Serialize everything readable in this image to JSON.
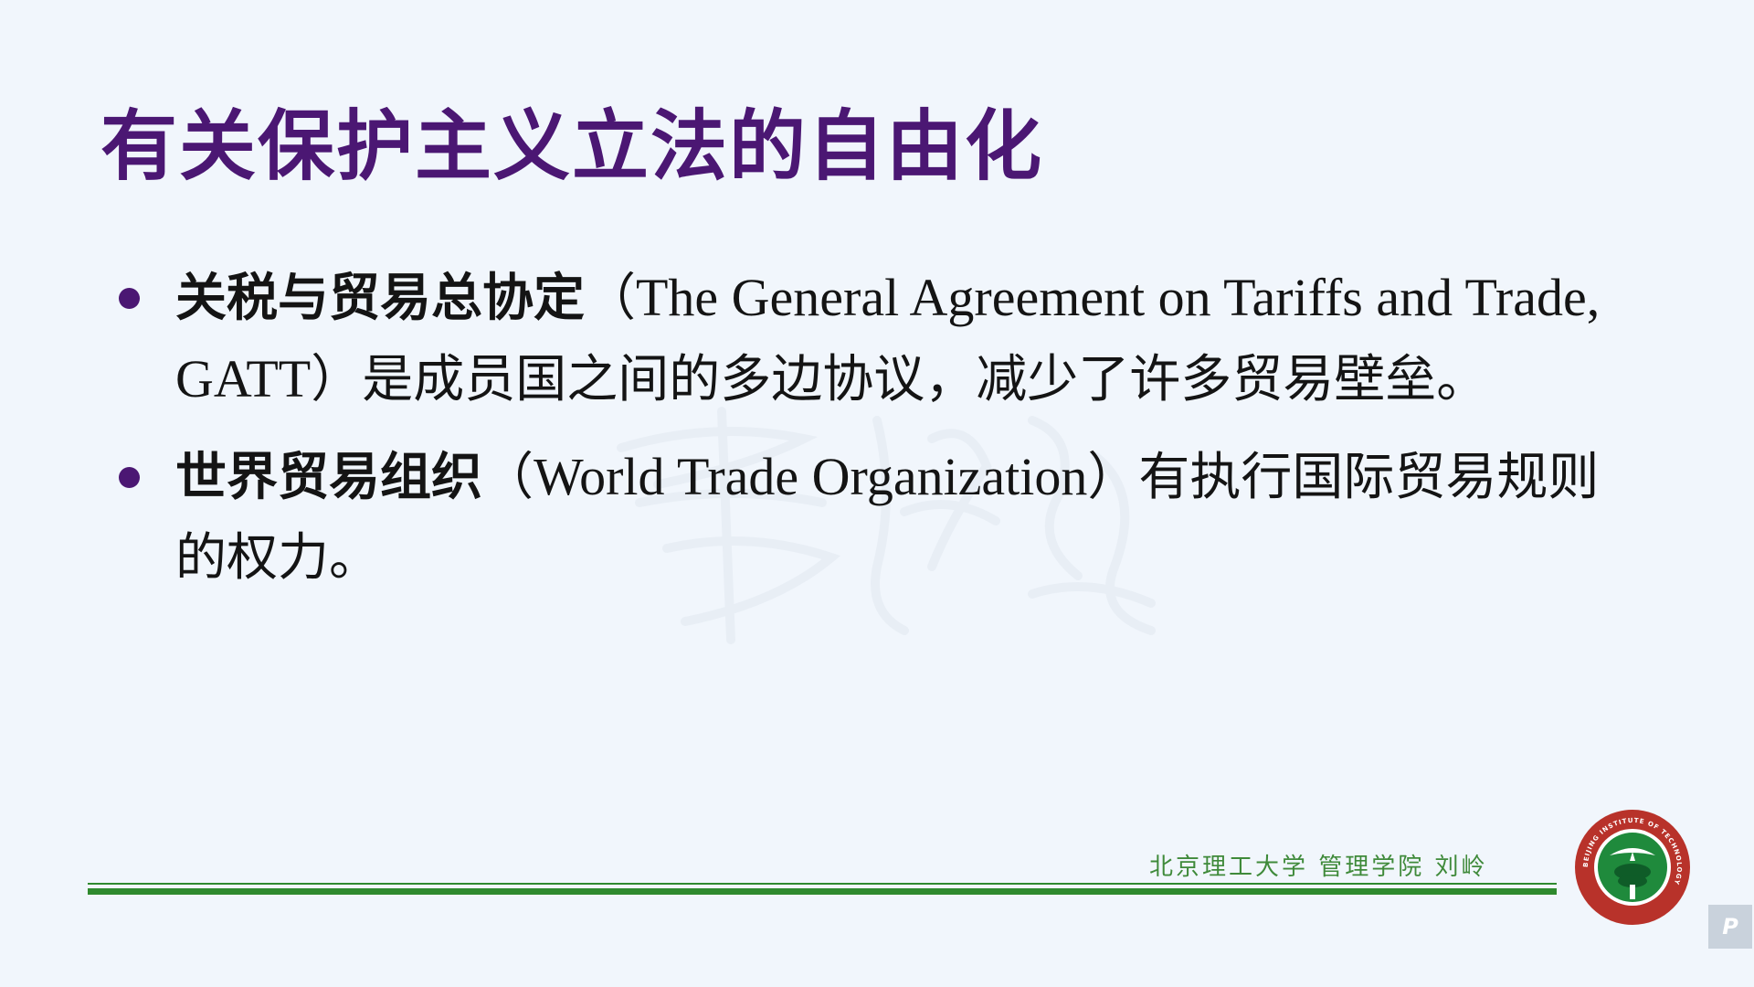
{
  "slide": {
    "title": "有关保护主义立法的自由化",
    "bullets": [
      {
        "term": "关税与贸易总协定",
        "paren_open": "（",
        "english": "The General Agreement on Tariffs and Trade, GATT",
        "paren_close": "）",
        "body": "是成员国之间的多边协议，减少了许多贸易壁垒。"
      },
      {
        "term": "世界贸易组织",
        "paren_open": "（",
        "english": "World Trade Organization",
        "paren_close": "）",
        "body": "有执行国际贸易规则的权力。"
      }
    ],
    "footer": {
      "text": "北京理工大学  管理学院  刘岭"
    },
    "logo": {
      "icon": "university-seal-icon",
      "text": "BEIJING INSTITUTE OF TECHNOLOGY"
    },
    "corner_button": {
      "icon": "presentation-tool-icon",
      "label": "P"
    }
  },
  "colors": {
    "background": "#f1f6fc",
    "title": "#4b1773",
    "bullet": "#4b1773",
    "body_text": "#141414",
    "footer_green": "#2f8a2e",
    "logo_red": "#b8322a"
  }
}
